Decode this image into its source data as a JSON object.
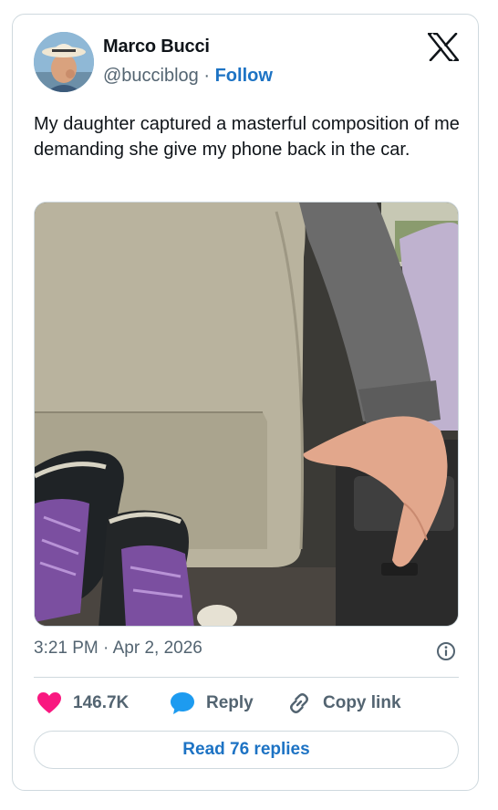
{
  "author": {
    "name": "Marco Bucci",
    "handle": "@bucciblog",
    "separator": " · ",
    "follow_label": "Follow"
  },
  "tweet": {
    "text": "My daughter captured a masterful composition of me demanding she give my phone back in the car."
  },
  "meta": {
    "time": "3:21 PM",
    "separator": " · ",
    "date": "Apr 2, 2026"
  },
  "actions": {
    "likes": "146.7K",
    "reply_label": "Reply",
    "copy_label": "Copy link"
  },
  "replies_button": {
    "label": "Read 76 replies"
  },
  "icons": {
    "brand": "x-logo-icon",
    "info": "info-icon",
    "like": "heart-icon",
    "reply": "speech-bubble-icon",
    "copy": "link-icon"
  },
  "colors": {
    "text": "#0f1419",
    "secondary": "#536471",
    "link": "#1d73c4",
    "like": "#f91880",
    "reply": "#1d9bf0",
    "border": "#cfd9de"
  }
}
